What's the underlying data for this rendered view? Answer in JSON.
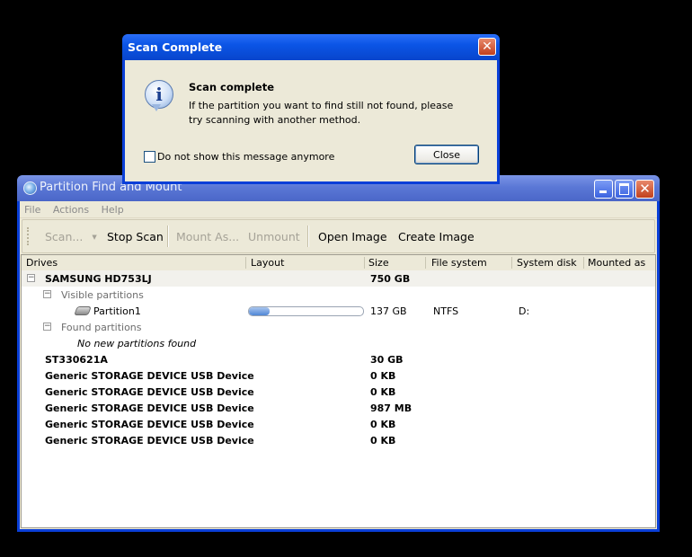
{
  "dialog": {
    "title": "Scan Complete",
    "close_glyph": "✕",
    "heading": "Scan complete",
    "message": "If the partition you want to find still not found, please try scanning with another method.",
    "checkbox_label": "Do not show this message anymore",
    "checkbox_checked": false,
    "close_button": "Close",
    "icon": "info-icon"
  },
  "window": {
    "title": "Partition Find and Mount",
    "icon": "app-disc-icon"
  },
  "menu": [
    "File",
    "Actions",
    "Help"
  ],
  "toolbar": {
    "scan": "Scan...",
    "stop_scan": "Stop Scan",
    "mount_as": "Mount As...",
    "unmount": "Unmount",
    "open_image": "Open Image",
    "create_image": "Create Image"
  },
  "columns": [
    "Drives",
    "Layout",
    "Size",
    "File system",
    "System disk",
    "Mounted as"
  ],
  "rows": [
    {
      "name": "SAMSUNG HD753LJ",
      "size": "750 GB"
    },
    {
      "name": "Visible partitions"
    },
    {
      "name": "Partition1",
      "layout_fill": 0.18,
      "size": "137 GB",
      "fs": "NTFS",
      "sysdisk": "D:"
    },
    {
      "name": "Found partitions"
    },
    {
      "name": "No new partitions found"
    },
    {
      "name": "ST330621A",
      "size": "30 GB"
    },
    {
      "name": "Generic STORAGE DEVICE USB Device",
      "size": "0 KB"
    },
    {
      "name": "Generic STORAGE DEVICE USB Device",
      "size": "0 KB"
    },
    {
      "name": "Generic STORAGE DEVICE USB Device",
      "size": "987 MB"
    },
    {
      "name": "Generic STORAGE DEVICE USB Device",
      "size": "0 KB"
    },
    {
      "name": "Generic STORAGE DEVICE USB Device",
      "size": "0 KB"
    }
  ],
  "tree_glyphs": {
    "collapse": "−"
  }
}
